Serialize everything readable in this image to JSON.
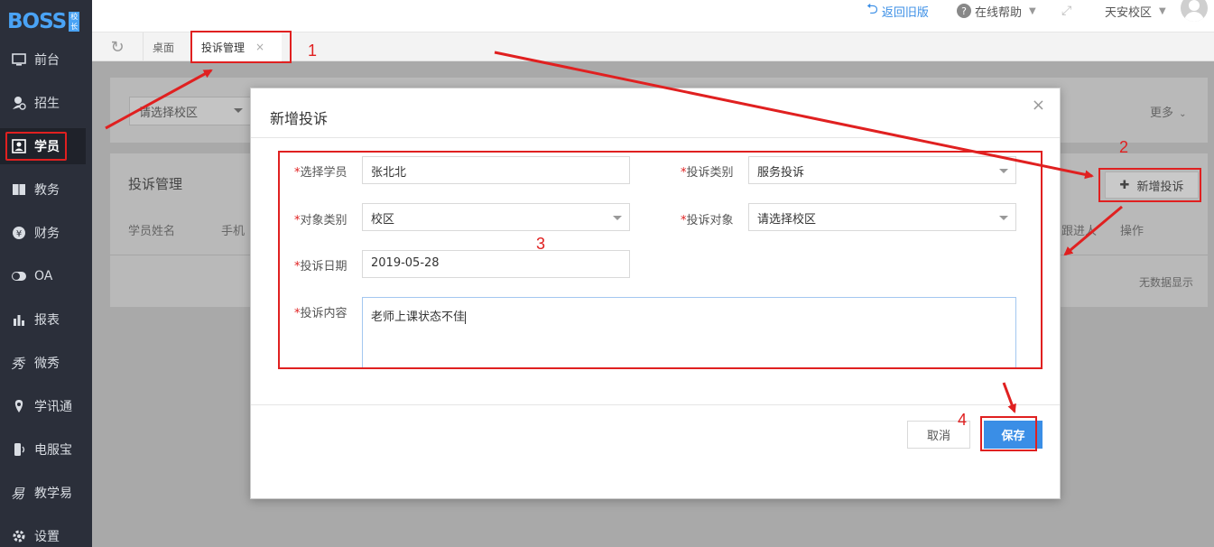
{
  "app": {
    "logo_text": "BOSS",
    "logo_badge": "校长"
  },
  "sidebar": {
    "items": [
      {
        "label": "前台",
        "icon": "monitor-icon"
      },
      {
        "label": "招生",
        "icon": "user-add-icon"
      },
      {
        "label": "学员",
        "icon": "student-card-icon"
      },
      {
        "label": "教务",
        "icon": "book-icon"
      },
      {
        "label": "财务",
        "icon": "yen-icon"
      },
      {
        "label": "OA",
        "icon": "toggle-icon"
      },
      {
        "label": "报表",
        "icon": "bar-chart-icon"
      },
      {
        "label": "微秀",
        "icon": "weixiu-icon"
      },
      {
        "label": "学讯通",
        "icon": "location-icon"
      },
      {
        "label": "电服宝",
        "icon": "phone-service-icon"
      },
      {
        "label": "教学易",
        "icon": "teach-icon"
      },
      {
        "label": "设置",
        "icon": "gear-icon"
      }
    ]
  },
  "topbar": {
    "back_old": "返回旧版",
    "help": "在线帮助",
    "campus": "天安校区"
  },
  "tabs": {
    "home": "桌面",
    "current": "投诉管理",
    "close": "×"
  },
  "page": {
    "filter_placeholder": "请选择校区",
    "more": "更多",
    "section_title": "投诉管理",
    "add_button": "新增投诉",
    "columns": [
      "学员姓名",
      "手机",
      "跟进人",
      "操作"
    ],
    "empty_text": "无数据显示"
  },
  "modal": {
    "title": "新增投诉",
    "close": "×",
    "fields": {
      "student_label": "选择学员",
      "student_value": "张北北",
      "category_label": "投诉类别",
      "category_value": "服务投诉",
      "target_type_label": "对象类别",
      "target_type_value": "校区",
      "target_label": "投诉对象",
      "target_placeholder": "请选择校区",
      "date_label": "投诉日期",
      "date_value": "2019-05-28",
      "content_label": "投诉内容",
      "content_value": "老师上课状态不佳"
    },
    "cancel": "取消",
    "save": "保存"
  },
  "annotations": {
    "n1": "1",
    "n2": "2",
    "n3": "3",
    "n4": "4"
  },
  "colors": {
    "annotation": "#e02020",
    "primary": "#3a8ee6",
    "sidebar_bg": "#2b2f3a"
  }
}
